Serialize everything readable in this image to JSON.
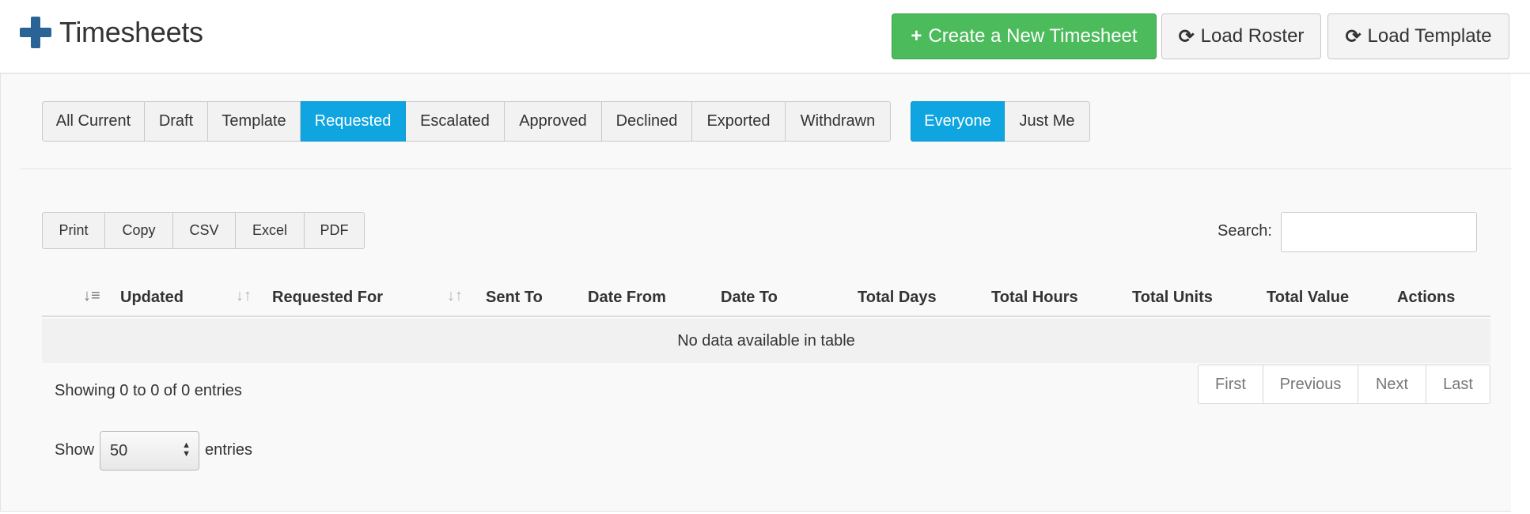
{
  "header": {
    "title": "Timesheets",
    "create_label": "Create a New Timesheet",
    "roster_label": "Load Roster",
    "template_label": "Load Template"
  },
  "status_filters": [
    {
      "label": "All Current",
      "active": false
    },
    {
      "label": "Draft",
      "active": false
    },
    {
      "label": "Template",
      "active": false
    },
    {
      "label": "Requested",
      "active": true
    },
    {
      "label": "Escalated",
      "active": false
    },
    {
      "label": "Approved",
      "active": false
    },
    {
      "label": "Declined",
      "active": false
    },
    {
      "label": "Exported",
      "active": false
    },
    {
      "label": "Withdrawn",
      "active": false
    }
  ],
  "owner_filters": [
    {
      "label": "Everyone",
      "active": true
    },
    {
      "label": "Just Me",
      "active": false
    }
  ],
  "export_buttons": [
    "Print",
    "Copy",
    "CSV",
    "Excel",
    "PDF"
  ],
  "search": {
    "label": "Search:",
    "value": ""
  },
  "table": {
    "columns": [
      "Updated",
      "Requested For",
      "Sent To",
      "Date From",
      "Date To",
      "Total Days",
      "Total Hours",
      "Total Units",
      "Total Value",
      "Actions"
    ],
    "empty_message": "No data available in table"
  },
  "info": "Showing 0 to 0 of 0 entries",
  "pagination": [
    "First",
    "Previous",
    "Next",
    "Last"
  ],
  "length": {
    "show_label": "Show",
    "value": "50",
    "entries_label": "entries"
  },
  "colors": {
    "primary_green": "#4cbb5b",
    "active_blue": "#0ea5e0",
    "brand_blue": "#2a6496"
  }
}
